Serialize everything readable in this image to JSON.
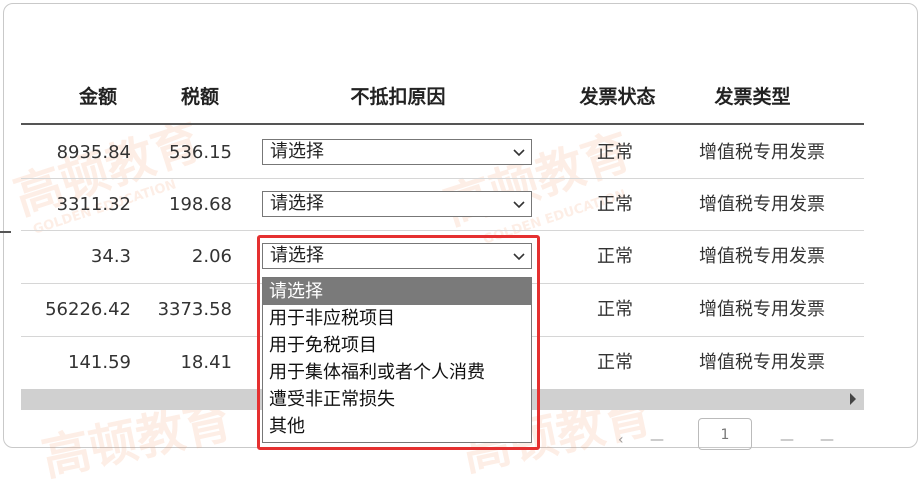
{
  "table": {
    "columns": [
      "金额",
      "税额",
      "不抵扣原因",
      "发票状态",
      "发票类型"
    ],
    "rows": [
      {
        "amount": "8935.84",
        "tax": "536.15",
        "reason": "请选择",
        "status": "正常",
        "type": "增值税专用发票"
      },
      {
        "amount": "3311.32",
        "tax": "198.68",
        "reason": "请选择",
        "status": "正常",
        "type": "增值税专用发票"
      },
      {
        "amount": "34.3",
        "tax": "2.06",
        "reason": "请选择",
        "status": "正常",
        "type": "增值税专用发票"
      },
      {
        "amount": "56226.42",
        "tax": "3373.58",
        "reason": "",
        "status": "正常",
        "type": "增值税专用发票"
      },
      {
        "amount": "141.59",
        "tax": "18.41",
        "reason": "",
        "status": "正常",
        "type": "增值税专用发票"
      }
    ]
  },
  "dropdown": {
    "options": [
      "请选择",
      "用于非应税项目",
      "用于免税项目",
      "用于集体福利或者个人消费",
      "遭受非正常损失",
      "其他"
    ],
    "selected_index": 0
  },
  "pager": {
    "current_page": "1"
  },
  "watermark": {
    "text": "高顿教育",
    "sub": "GOLDEN EDUCATION"
  },
  "colors": {
    "highlight": "#e53030",
    "selected_option_bg": "#7a7a7a",
    "header_rule": "#555555"
  },
  "icons": {
    "select_arrow": "chevron-down-icon",
    "scroll_arrow": "caret-right-icon"
  }
}
